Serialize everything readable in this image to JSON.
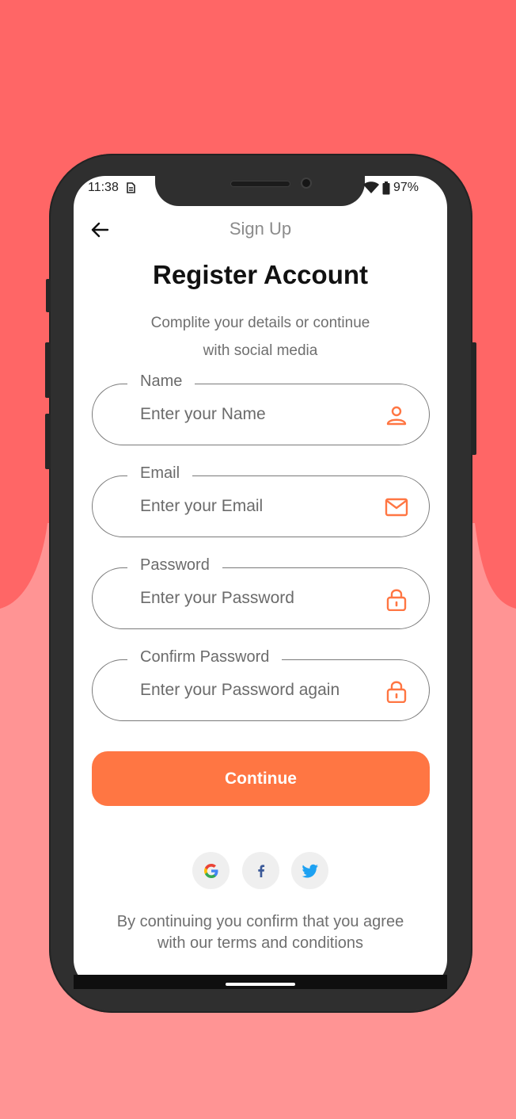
{
  "colors": {
    "background_top": "#FF6666",
    "background_bottom": "#FF9494",
    "accent": "#FF7643",
    "phone_frame": "#2F2F2F"
  },
  "status_bar": {
    "time": "11:38",
    "battery": "97%",
    "icons": [
      "sim-icon",
      "wifi-icon",
      "battery-icon"
    ]
  },
  "top_bar": {
    "back_icon": "arrow-left-icon",
    "title": "Sign Up"
  },
  "heading": "Register Account",
  "subtitle_line1": "Complite your details or continue",
  "subtitle_line2": "with social media",
  "fields": [
    {
      "label": "Name",
      "placeholder": "Enter your Name",
      "icon": "user-icon"
    },
    {
      "label": "Email",
      "placeholder": "Enter your Email",
      "icon": "mail-icon"
    },
    {
      "label": "Password",
      "placeholder": "Enter your Password",
      "icon": "lock-icon"
    },
    {
      "label": "Confirm Password",
      "placeholder": "Enter your Password again",
      "icon": "lock-icon"
    }
  ],
  "continue_label": "Continue",
  "social": [
    "google-icon",
    "facebook-icon",
    "twitter-icon"
  ],
  "terms_line1": "By continuing you confirm that you agree",
  "terms_line2": "with our terms and conditions"
}
